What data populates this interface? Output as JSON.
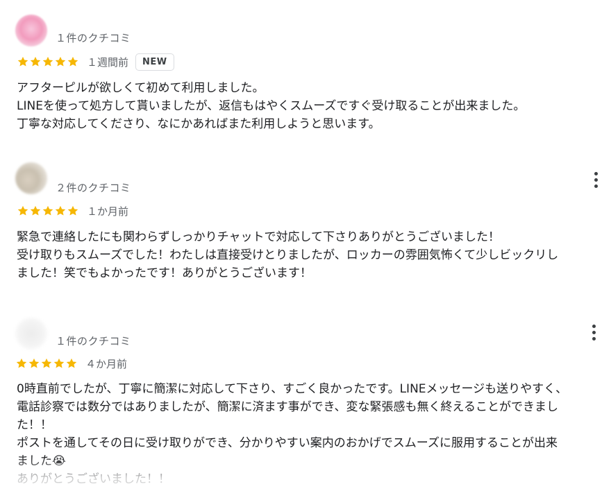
{
  "colors": {
    "star": "#f6b704",
    "secondary_text": "#5f6368",
    "body_text": "#202124"
  },
  "reviews": [
    {
      "avatar_icon": "blurred-profile-photo",
      "count": "１件のクチコミ",
      "rating": 5,
      "time": "１週間前",
      "badge": "NEW",
      "lines": [
        "アフターピルが欲しくて初めて利用しました。",
        "LINEを使って処方して貰いましたが、返信もはやくスムーズですぐ受け取ることが出来ました。",
        "丁寧な対応してくださり、なにかあればまた利用しようと思います。"
      ]
    },
    {
      "avatar_icon": "blurred-profile-photo",
      "count": "２件のクチコミ",
      "rating": 5,
      "time": "１か月前",
      "more_icon": "more-vertical-icon",
      "lines": [
        "緊急で連絡したにも関わらずしっかりチャットで対応して下さりありがとうございました！",
        "受け取りもスムーズでした！わたしは直接受けとりましたが、ロッカーの雰囲気怖くて少しビックリし",
        "ました！笑でもよかったです！ありがとうございます！"
      ]
    },
    {
      "avatar_icon": "blurred-profile-photo",
      "count": "１件のクチコミ",
      "rating": 5,
      "time": "４か月前",
      "more_icon": "more-vertical-icon",
      "lines": [
        "0時直前でしたが、丁寧に簡潔に対応して下さり、すごく良かったです。LINEメッセージも送りやすく、",
        "電話診察では数分ではありましたが、簡潔に済ます事ができ、変な緊張感も無く終えることができまし",
        "た！！",
        "ポストを通してその日に受け取りができ、分かりやすい案内のおかげでスムーズに服用することが出来",
        "ました😭",
        "ありがとうございました！！"
      ]
    }
  ]
}
